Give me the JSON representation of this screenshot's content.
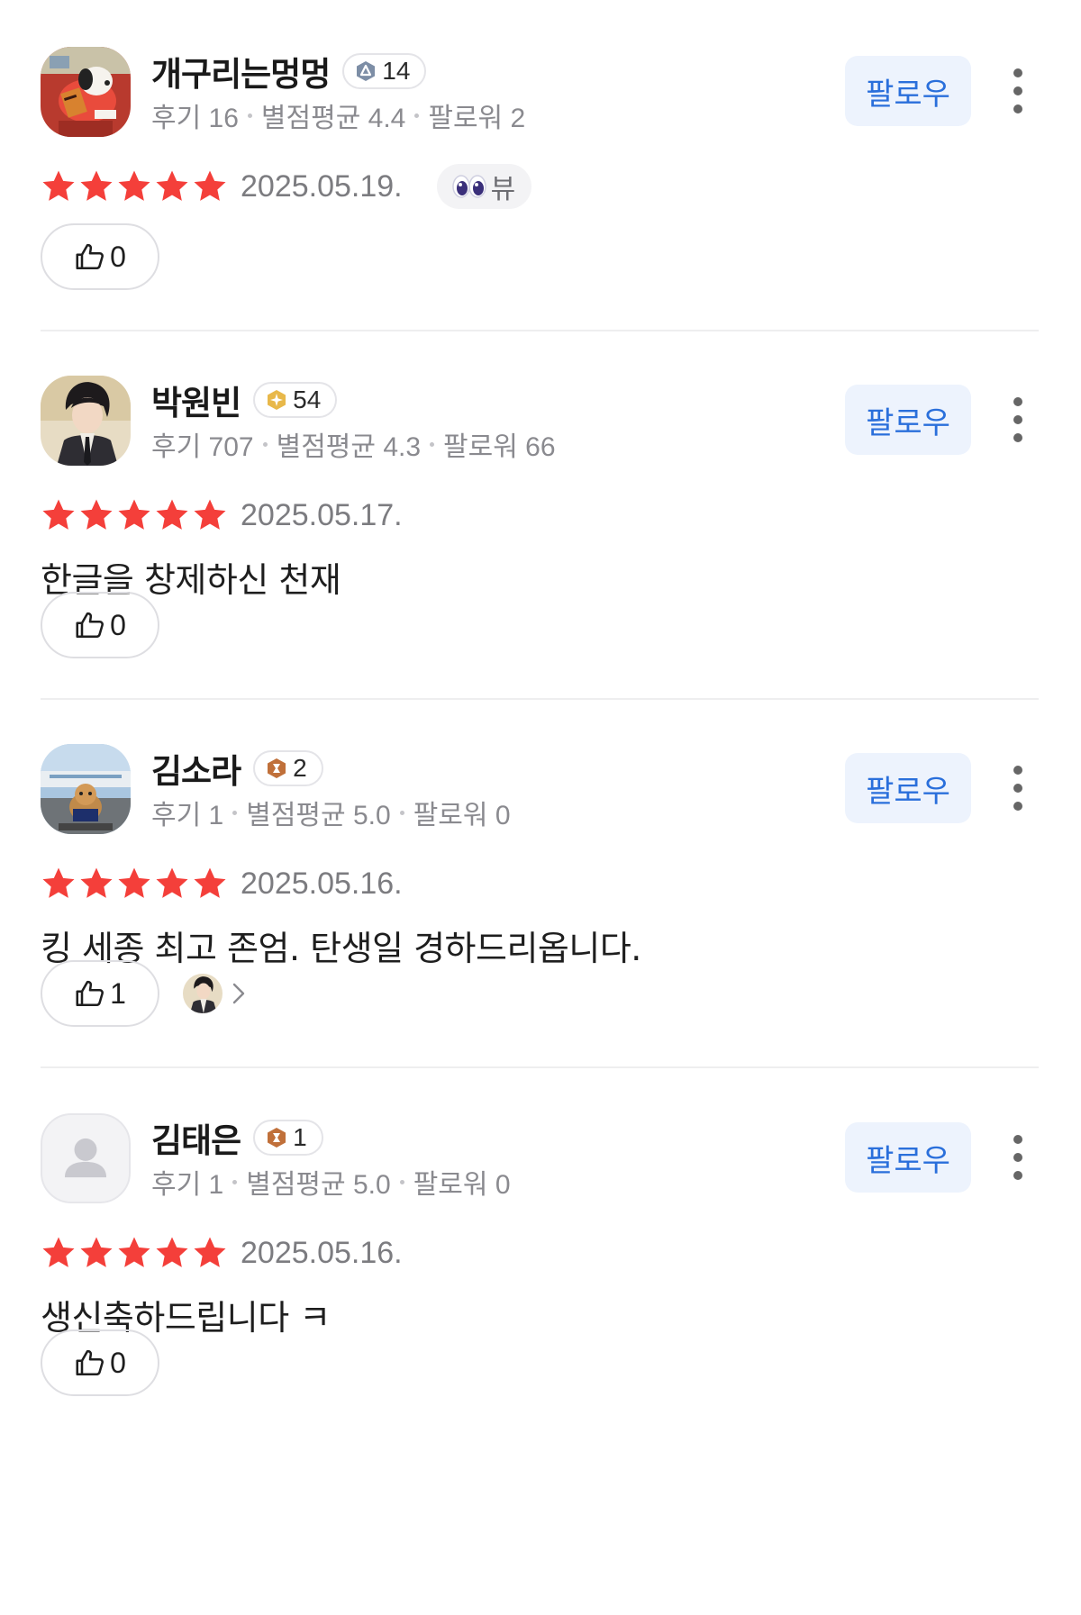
{
  "reviews": [
    {
      "name": "개구리는멍멍",
      "level": "14",
      "level_tier": "silver",
      "stats": {
        "reviews": "후기 16",
        "avg_rating": "별점평균 4.4",
        "followers": "팔로워 2"
      },
      "follow_label": "팔로우",
      "rating": 5,
      "date": "2025.05.19.",
      "tag": "뷰",
      "text": "",
      "likes": "0",
      "has_liker": false
    },
    {
      "name": "박원빈",
      "level": "54",
      "level_tier": "gold",
      "stats": {
        "reviews": "후기 707",
        "avg_rating": "별점평균 4.3",
        "followers": "팔로워 66"
      },
      "follow_label": "팔로우",
      "rating": 5,
      "date": "2025.05.17.",
      "tag": "",
      "text": "한글을 창제하신 천재",
      "likes": "0",
      "has_liker": false
    },
    {
      "name": "김소라",
      "level": "2",
      "level_tier": "bronze",
      "stats": {
        "reviews": "후기 1",
        "avg_rating": "별점평균 5.0",
        "followers": "팔로워 0"
      },
      "follow_label": "팔로우",
      "rating": 5,
      "date": "2025.05.16.",
      "tag": "",
      "text": "킹 세종 최고 존엄. 탄생일 경하드리옵니다.",
      "likes": "1",
      "has_liker": true
    },
    {
      "name": "김태은",
      "level": "1",
      "level_tier": "bronze",
      "stats": {
        "reviews": "후기 1",
        "avg_rating": "별점평균 5.0",
        "followers": "팔로워 0"
      },
      "follow_label": "팔로우",
      "rating": 5,
      "date": "2025.05.16.",
      "tag": "",
      "text": "생신축하드립니다 ㅋ",
      "likes": "0",
      "has_liker": false
    }
  ],
  "colors": {
    "star": "#f43f3a",
    "follow_text": "#2a6fdb",
    "follow_bg": "#edf3fd",
    "meta_text": "#8a8a8f",
    "badge_silver": "#7d8ea6",
    "badge_gold": "#e8b84a",
    "badge_bronze": "#c0703a"
  }
}
